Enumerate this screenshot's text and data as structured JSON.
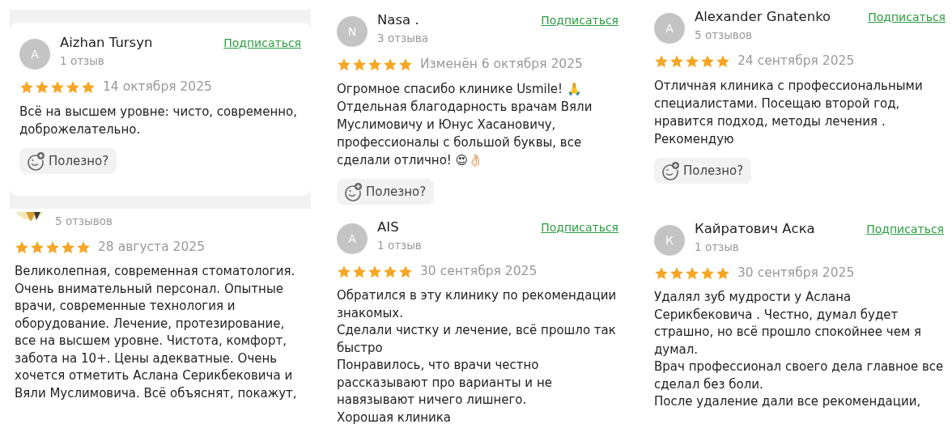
{
  "reviews": [
    {
      "avatar": {
        "kind": "letter",
        "letter": "A"
      },
      "name": "Aizhan Tursyn",
      "count": "1 отзыв",
      "subscribe": "Подписаться",
      "stars": 5,
      "date": "14 октября 2025",
      "text": "Всё на высшем уровне: чисто, современно,\nдоброжелательно.",
      "helpful": "Полезно?"
    },
    {
      "avatar": {
        "kind": "letter",
        "letter": "N"
      },
      "name": "Nasa .",
      "count": "3 отзыва",
      "subscribe": "Подписаться",
      "stars": 5,
      "date": "Изменён 6 октября 2025",
      "text": "Огромное спасибо клинике Usmile! 🙏\nОтдельная благодарность врачам Вяли\nМуслимовичу и Юнус Хасановичу,\nпрофессионалы с большой буквы, все\nсделали отлично! 😍👌🏻",
      "helpful": "Полезно?"
    },
    {
      "avatar": {
        "kind": "letter",
        "letter": "A"
      },
      "name": "Alexander Gnatenko",
      "count": "5 отзывов",
      "subscribe": "Подписаться",
      "stars": 5,
      "date": "24 сентября 2025",
      "text": "Отличная клиника с профессиональными\nспециалистами. Посещаю второй год,\nнравится подход, методы лечения .\nРекомендую",
      "helpful": "Полезно?"
    },
    {
      "count": "5 отзывов",
      "stars": 5,
      "date": "28 августа 2025",
      "text": "Великолепная, современная стоматология.\nОчень внимательный персонал. Опытные\nврачи, современные технология и\nоборудование. Лечение, протезирование,\nвсе на высшем уровне. Чистота, комфорт,\nзабота на 10+. Цены адекватные. Очень\nхочется отметить Аслана Серикбековича и\nВяли Муслимовича. Всё объяснят, покажут,"
    },
    {
      "avatar": {
        "kind": "letter",
        "letter": "A"
      },
      "name": "AIS",
      "count": "1 отзыв",
      "subscribe": "Подписаться",
      "stars": 5,
      "date": "30 сентября 2025",
      "text": "Обратился в эту клинику по рекомендации\nзнакомых.\nСделали чистку и лечение, всё прошло так\nбыстро\nПонравилось, что врачи честно\nрассказывают про варианты и не\nнавязывают ничего лишнего.\nХорошая клиника"
    },
    {
      "avatar": {
        "kind": "letter",
        "letter": "К"
      },
      "name": "Кайратович Аска",
      "count": "1 отзыв",
      "subscribe": "Подписаться",
      "stars": 5,
      "date": "30 сентября 2025",
      "text": "Удалял зуб мудрости у Аслана\nСерикбековича . Честно, думал будет\nстрашно, но всё прошло спокойнее чем я\nдумал.\nВрач профессионал своего дела главное все\nсделал без боли.\nПосле удаление дали все рекомендации,"
    }
  ]
}
